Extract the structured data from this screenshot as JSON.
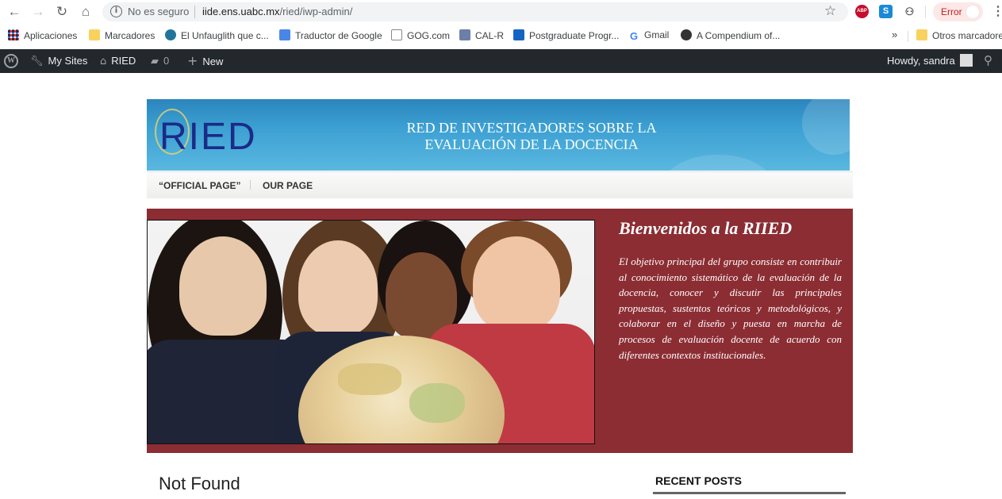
{
  "browser": {
    "security_label": "No es seguro",
    "url_host": "iide.ens.uabc.mx",
    "url_path": "/ried/iwp-admin/",
    "error_label": "Error",
    "ext_abp": "ABP",
    "ext_s": "S"
  },
  "bookmarks": {
    "items": [
      {
        "label": "Aplicaciones",
        "icon": "apps-icon"
      },
      {
        "label": "Marcadores",
        "icon": "folder-icon"
      },
      {
        "label": "El Unfauglith que c...",
        "icon": "wordpress-icon"
      },
      {
        "label": "Traductor de Google",
        "icon": "translate-icon"
      },
      {
        "label": "GOG.com",
        "icon": "gog-icon"
      },
      {
        "label": "CAL-R",
        "icon": "cal-icon"
      },
      {
        "label": "Postgraduate Progr...",
        "icon": "postgraduate-icon"
      },
      {
        "label": "Gmail",
        "icon": "google-icon"
      },
      {
        "label": "A Compendium of...",
        "icon": "compendium-icon"
      }
    ],
    "more": "»",
    "other": "Otros marcadores"
  },
  "adminbar": {
    "my_sites": "My Sites",
    "site_name": "RIED",
    "comments_count": "0",
    "new_label": "New",
    "howdy": "Howdy, sandra"
  },
  "site": {
    "logo_text": "RIED",
    "banner_title": "RED DE INVESTIGADORES  SOBRE LA\nEVALUACIÓN DE LA DOCENCIA",
    "nav": [
      "“OFFICIAL PAGE”",
      "OUR PAGE"
    ],
    "hero_heading": "Bienvenidos a la RIIED",
    "hero_text": "El objetivo principal del grupo consiste en contribuir al conocimiento sistemático de la evaluación de la docencia, conocer y discutir las principales propuestas, sustentos teóricos y metodológicos, y colaborar en el diseño y puesta en marcha de procesos de evaluación docente de acuerdo con diferentes contextos institucionales.",
    "not_found": "Not Found",
    "recent_posts": "RECENT POSTS"
  },
  "colors": {
    "hero_bg": "#8b2d33",
    "adminbar_bg": "#23282d",
    "banner_blue": "#3ca0d2"
  }
}
